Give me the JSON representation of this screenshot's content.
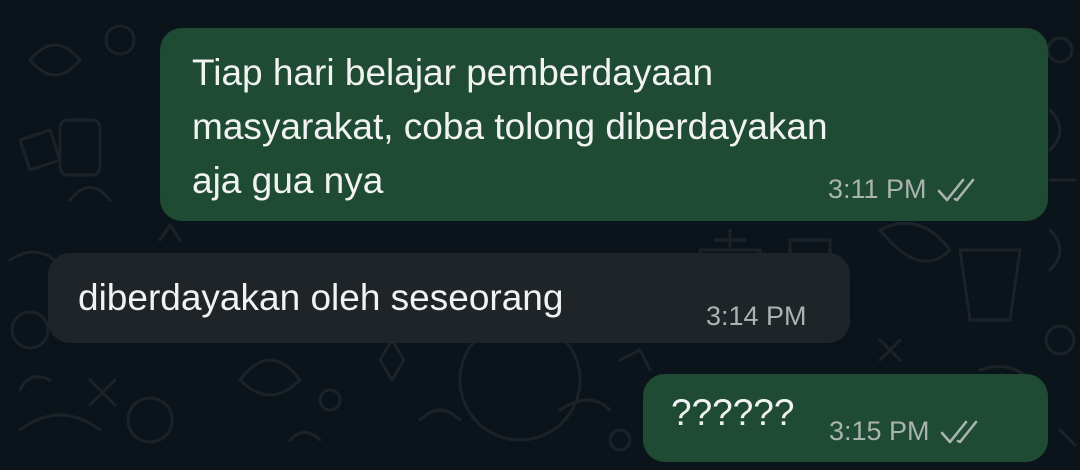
{
  "chat": {
    "messages": [
      {
        "direction": "outgoing",
        "text": "Tiap hari belajar pemberdayaan\nmasyarakat, coba tolong diberdayakan\naja gua nya",
        "time": "3:11 PM",
        "status_icon": "double-check-icon"
      },
      {
        "direction": "incoming",
        "text": "diberdayakan oleh seseorang",
        "time": "3:14 PM"
      },
      {
        "direction": "outgoing",
        "text": "??????",
        "time": "3:15 PM",
        "status_icon": "double-check-icon"
      }
    ]
  },
  "colors": {
    "background": "#0b141a",
    "outgoing_bubble": "#1f4a33",
    "incoming_bubble": "#1f2428",
    "text": "#f1f3f2",
    "meta_text": "#a9b4b0"
  }
}
